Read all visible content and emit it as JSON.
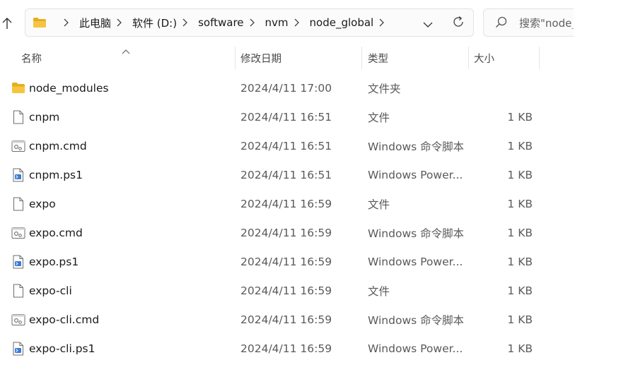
{
  "address_bar": {
    "breadcrumbs": [
      "此电脑",
      "软件 (D:)",
      "software",
      "nvm",
      "node_global"
    ]
  },
  "search": {
    "value": "搜索\"node_"
  },
  "columns": {
    "name": "名称",
    "date": "修改日期",
    "type": "类型",
    "size": "大小"
  },
  "files": [
    {
      "name": "node_modules",
      "date": "2024/4/11 17:00",
      "type": "文件夹",
      "size": "",
      "icon": "folder-icon"
    },
    {
      "name": "cnpm",
      "date": "2024/4/11 16:51",
      "type": "文件",
      "size": "1 KB",
      "icon": "file-icon"
    },
    {
      "name": "cnpm.cmd",
      "date": "2024/4/11 16:51",
      "type": "Windows 命令脚本",
      "size": "1 KB",
      "icon": "cmd-script-icon"
    },
    {
      "name": "cnpm.ps1",
      "date": "2024/4/11 16:51",
      "type": "Windows Power...",
      "size": "1 KB",
      "icon": "powershell-script-icon"
    },
    {
      "name": "expo",
      "date": "2024/4/11 16:59",
      "type": "文件",
      "size": "1 KB",
      "icon": "file-icon"
    },
    {
      "name": "expo.cmd",
      "date": "2024/4/11 16:59",
      "type": "Windows 命令脚本",
      "size": "1 KB",
      "icon": "cmd-script-icon"
    },
    {
      "name": "expo.ps1",
      "date": "2024/4/11 16:59",
      "type": "Windows Power...",
      "size": "1 KB",
      "icon": "powershell-script-icon"
    },
    {
      "name": "expo-cli",
      "date": "2024/4/11 16:59",
      "type": "文件",
      "size": "1 KB",
      "icon": "file-icon"
    },
    {
      "name": "expo-cli.cmd",
      "date": "2024/4/11 16:59",
      "type": "Windows 命令脚本",
      "size": "1 KB",
      "icon": "cmd-script-icon"
    },
    {
      "name": "expo-cli.ps1",
      "date": "2024/4/11 16:59",
      "type": "Windows Power...",
      "size": "1 KB",
      "icon": "powershell-script-icon"
    }
  ],
  "colors": {
    "folder": "#f5c542",
    "folder_dark": "#e8ad1c",
    "accent": "#3a7bd5"
  }
}
